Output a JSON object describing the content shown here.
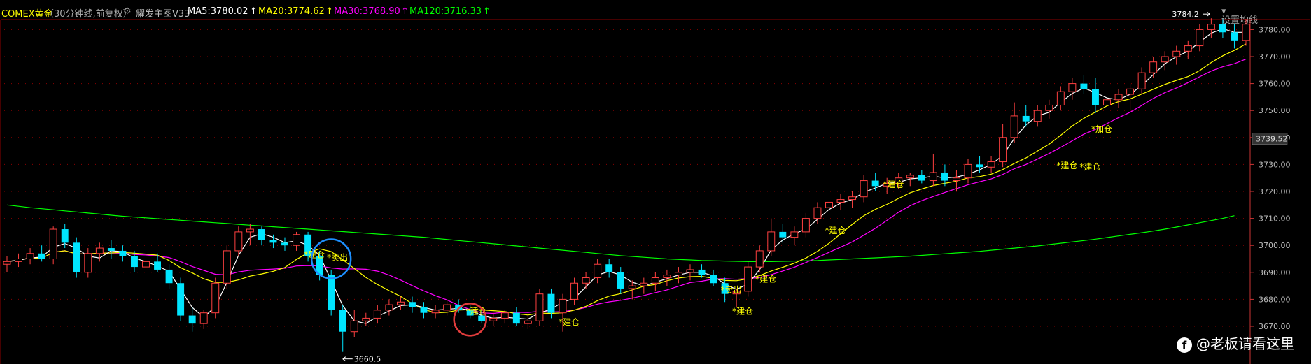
{
  "header": {
    "instrument": "COMEX黄金",
    "period": "（30分钟线,前复权）",
    "settings_icon": "gear-icon",
    "indicator_name": "耀发主图V33",
    "ma5": "MA5:3780.02",
    "ma20": "MA20:3774.62",
    "ma30": "MA30:3768.90",
    "ma120": "MA120:3716.33",
    "ma_settings": "设置均线",
    "colors": {
      "ma5": "#ffffff",
      "ma20": "#ffff00",
      "ma30": "#ff00ff",
      "ma120": "#00ff00"
    }
  },
  "watermark": {
    "icon": "facebook-icon",
    "text": "@老板请看这里"
  },
  "chart_data": {
    "type": "candlestick",
    "ylim": [
      3665,
      3788
    ],
    "y_ticks": [
      3670,
      3680,
      3690,
      3700,
      3710,
      3720,
      3730,
      3740,
      3750,
      3760,
      3770,
      3780
    ],
    "y_tick_labels": [
      "3670.00",
      "3680.00",
      "3690.00",
      "3700.00",
      "3710.00",
      "3720.00",
      "3730.00",
      "3740.00",
      "3750.00",
      "3760.00",
      "3770.00",
      "3780.00"
    ],
    "current_price_label": "3739.52",
    "current_price": 3739.52,
    "high_label": "3784.2",
    "high_value": 3784.2,
    "low_label": "3660.5",
    "low_value": 3660.5,
    "colors": {
      "up": "#ff4040",
      "down": "#00e5ff",
      "signal": "#ffff00",
      "ma5": "#ffffff",
      "ma20": "#ffff00",
      "ma30": "#ff00ff",
      "ma120": "#00ff00",
      "grid": "#8b0000",
      "axis": "#cc3333"
    },
    "candles": [
      [
        3693,
        3696,
        3690,
        3694
      ],
      [
        3694,
        3697,
        3692,
        3695
      ],
      [
        3695,
        3699,
        3693,
        3697
      ],
      [
        3697,
        3700,
        3694,
        3695
      ],
      [
        3695,
        3707,
        3693,
        3706
      ],
      [
        3706,
        3708,
        3699,
        3701
      ],
      [
        3701,
        3703,
        3688,
        3690
      ],
      [
        3690,
        3699,
        3688,
        3697
      ],
      [
        3697,
        3701,
        3694,
        3699
      ],
      [
        3699,
        3702,
        3695,
        3698
      ],
      [
        3698,
        3700,
        3694,
        3696
      ],
      [
        3696,
        3698,
        3690,
        3692
      ],
      [
        3692,
        3695,
        3688,
        3694
      ],
      [
        3694,
        3697,
        3690,
        3691
      ],
      [
        3691,
        3693,
        3684,
        3686
      ],
      [
        3686,
        3688,
        3672,
        3674
      ],
      [
        3674,
        3677,
        3668,
        3671
      ],
      [
        3671,
        3676,
        3669,
        3675
      ],
      [
        3675,
        3688,
        3673,
        3686
      ],
      [
        3686,
        3700,
        3684,
        3698
      ],
      [
        3698,
        3707,
        3696,
        3705
      ],
      [
        3705,
        3708,
        3700,
        3706
      ],
      [
        3706,
        3707,
        3700,
        3702
      ],
      [
        3702,
        3704,
        3699,
        3701
      ],
      [
        3701,
        3703,
        3698,
        3700
      ],
      [
        3700,
        3705,
        3698,
        3704
      ],
      [
        3704,
        3705,
        3694,
        3696
      ],
      [
        3696,
        3698,
        3687,
        3689
      ],
      [
        3689,
        3691,
        3674,
        3676
      ],
      [
        3676,
        3678,
        3660.5,
        3668
      ],
      [
        3668,
        3676,
        3666,
        3672
      ],
      [
        3672,
        3675,
        3670,
        3673
      ],
      [
        3673,
        3678,
        3671,
        3676
      ],
      [
        3676,
        3680,
        3674,
        3678
      ],
      [
        3678,
        3681,
        3676,
        3679
      ],
      [
        3679,
        3681,
        3675,
        3677
      ],
      [
        3677,
        3679,
        3673,
        3675
      ],
      [
        3675,
        3678,
        3673,
        3676
      ],
      [
        3676,
        3680,
        3674,
        3678
      ],
      [
        3678,
        3680,
        3675,
        3676
      ],
      [
        3676,
        3678,
        3673,
        3674
      ],
      [
        3674,
        3676,
        3671,
        3672
      ],
      [
        3672,
        3675,
        3670,
        3673
      ],
      [
        3673,
        3676,
        3671,
        3675
      ],
      [
        3675,
        3677,
        3670,
        3671
      ],
      [
        3671,
        3674,
        3669,
        3672
      ],
      [
        3672,
        3684,
        3670,
        3682
      ],
      [
        3682,
        3684,
        3673,
        3675
      ],
      [
        3675,
        3682,
        3668,
        3680
      ],
      [
        3680,
        3688,
        3678,
        3686
      ],
      [
        3686,
        3690,
        3684,
        3688
      ],
      [
        3688,
        3695,
        3686,
        3693
      ],
      [
        3693,
        3695,
        3688,
        3690
      ],
      [
        3690,
        3692,
        3682,
        3684
      ],
      [
        3684,
        3687,
        3680,
        3685
      ],
      [
        3685,
        3688,
        3682,
        3686
      ],
      [
        3686,
        3690,
        3683,
        3688
      ],
      [
        3688,
        3691,
        3685,
        3689
      ],
      [
        3689,
        3692,
        3686,
        3690
      ],
      [
        3690,
        3693,
        3687,
        3691
      ],
      [
        3691,
        3693,
        3688,
        3689
      ],
      [
        3689,
        3691,
        3685,
        3686
      ],
      [
        3686,
        3688,
        3679,
        3682
      ],
      [
        3682,
        3684,
        3677,
        3683
      ],
      [
        3683,
        3694,
        3681,
        3692
      ],
      [
        3692,
        3700,
        3690,
        3698
      ],
      [
        3698,
        3710,
        3696,
        3705
      ],
      [
        3705,
        3708,
        3701,
        3703
      ],
      [
        3703,
        3707,
        3700,
        3705
      ],
      [
        3705,
        3712,
        3703,
        3710
      ],
      [
        3710,
        3716,
        3708,
        3714
      ],
      [
        3714,
        3718,
        3712,
        3716
      ],
      [
        3716,
        3719,
        3713,
        3717
      ],
      [
        3717,
        3720,
        3714,
        3718
      ],
      [
        3718,
        3726,
        3716,
        3724
      ],
      [
        3724,
        3727,
        3720,
        3722
      ],
      [
        3722,
        3725,
        3719,
        3723
      ],
      [
        3723,
        3727,
        3721,
        3725
      ],
      [
        3725,
        3727,
        3722,
        3726
      ],
      [
        3726,
        3728,
        3723,
        3724
      ],
      [
        3724,
        3734,
        3722,
        3727
      ],
      [
        3727,
        3730,
        3722,
        3724
      ],
      [
        3724,
        3728,
        3720,
        3725
      ],
      [
        3725,
        3732,
        3723,
        3730
      ],
      [
        3730,
        3733,
        3727,
        3729
      ],
      [
        3729,
        3733,
        3727,
        3731
      ],
      [
        3731,
        3745,
        3729,
        3740
      ],
      [
        3740,
        3753,
        3738,
        3748
      ],
      [
        3748,
        3752,
        3744,
        3746
      ],
      [
        3746,
        3752,
        3744,
        3750
      ],
      [
        3750,
        3754,
        3747,
        3752
      ],
      [
        3752,
        3759,
        3750,
        3757
      ],
      [
        3757,
        3762,
        3754,
        3760
      ],
      [
        3760,
        3763,
        3756,
        3758
      ],
      [
        3758,
        3762,
        3749,
        3752
      ],
      [
        3752,
        3756,
        3748,
        3754
      ],
      [
        3754,
        3758,
        3751,
        3756
      ],
      [
        3756,
        3760,
        3750,
        3758
      ],
      [
        3758,
        3766,
        3756,
        3764
      ],
      [
        3764,
        3770,
        3762,
        3768
      ],
      [
        3768,
        3772,
        3765,
        3770
      ],
      [
        3770,
        3774,
        3767,
        3772
      ],
      [
        3772,
        3776,
        3769,
        3774
      ],
      [
        3774,
        3782,
        3772,
        3780
      ],
      [
        3780,
        3784.2,
        3777,
        3782
      ],
      [
        3782,
        3784,
        3777,
        3779
      ],
      [
        3779,
        3782,
        3773,
        3776
      ],
      [
        3776,
        3784,
        3774,
        3782
      ]
    ],
    "ma120_values": [
      3715,
      3714.5,
      3714,
      3713.6,
      3713.2,
      3712.8,
      3712.4,
      3712,
      3711.6,
      3711.2,
      3710.8,
      3710.5,
      3710.2,
      3709.9,
      3709.6,
      3709.3,
      3709,
      3708.7,
      3708.4,
      3708.1,
      3707.8,
      3707.5,
      3707.2,
      3706.9,
      3706.6,
      3706.3,
      3706,
      3705.7,
      3705.4,
      3705.1,
      3704.8,
      3704.5,
      3704.2,
      3703.9,
      3703.6,
      3703.3,
      3703,
      3702.6,
      3702.2,
      3701.8,
      3701.4,
      3701,
      3700.6,
      3700.2,
      3699.8,
      3699.4,
      3699,
      3698.6,
      3698.2,
      3697.8,
      3697.4,
      3697,
      3696.6,
      3696.2,
      3695.9,
      3695.6,
      3695.3,
      3695,
      3694.8,
      3694.6,
      3694.4,
      3694.3,
      3694.2,
      3694.1,
      3694,
      3694,
      3694,
      3694.1,
      3694.2,
      3694.3,
      3694.4,
      3694.6,
      3694.8,
      3695,
      3695.2,
      3695.4,
      3695.6,
      3695.8,
      3696,
      3696.3,
      3696.6,
      3696.9,
      3697.2,
      3697.5,
      3697.8,
      3698.2,
      3698.6,
      3699,
      3699.4,
      3699.8,
      3700.3,
      3700.8,
      3701.3,
      3701.8,
      3702.3,
      3702.9,
      3703.5,
      3704.1,
      3704.7,
      3705.3,
      3706,
      3706.8,
      3707.6,
      3708.4,
      3709.2,
      3710,
      3711
    ],
    "signals": [
      {
        "label": "建仓",
        "index": 26,
        "value": 3695.5
      },
      {
        "label": "卖出",
        "index": 28,
        "value": 3694.5
      },
      {
        "label": "建仓",
        "index": 40,
        "value": 3674.5
      },
      {
        "label": "建仓",
        "index": 48,
        "value": 3670.5
      },
      {
        "label": "卖出",
        "index": 62,
        "value": 3682.5
      },
      {
        "label": "建仓",
        "index": 65,
        "value": 3686.5
      },
      {
        "label": "建仓",
        "index": 63,
        "value": 3674.5
      },
      {
        "label": "建仓",
        "index": 71,
        "value": 3704.5
      },
      {
        "label": "建仓",
        "index": 76,
        "value": 3721.5
      },
      {
        "label": "建仓",
        "index": 91,
        "value": 3728.5
      },
      {
        "label": "建仓",
        "index": 93,
        "value": 3728
      },
      {
        "label": "加仓",
        "index": 94,
        "value": 3742
      }
    ],
    "annotations": [
      {
        "shape": "circle",
        "color": "#1e90ff",
        "index": 28,
        "value": 3695
      },
      {
        "shape": "circle",
        "color": "#e23c3c",
        "index": 40,
        "value": 3672.5
      }
    ]
  }
}
